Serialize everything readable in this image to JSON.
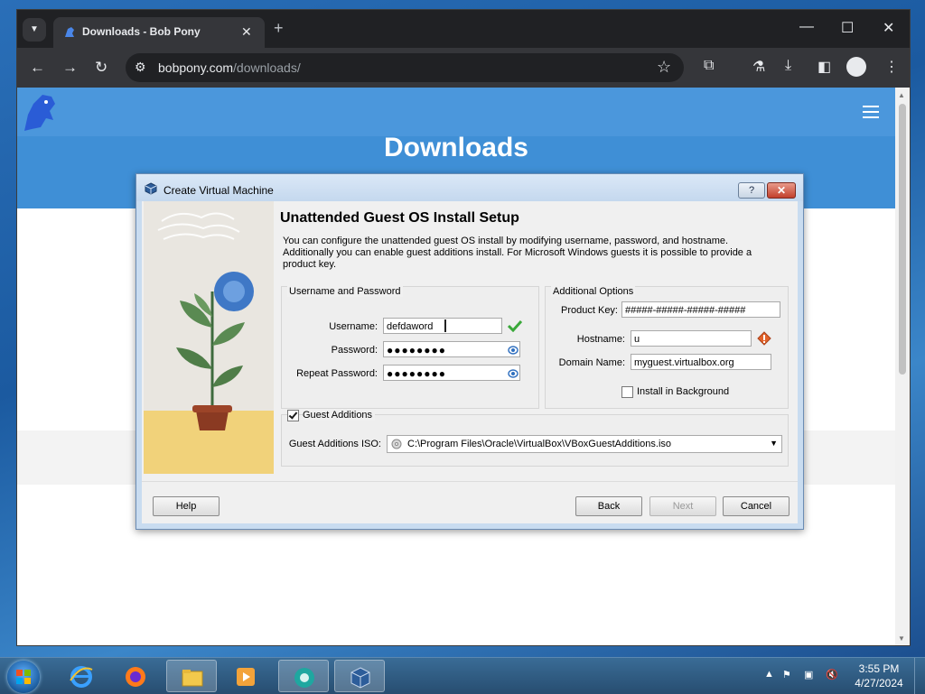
{
  "browser": {
    "tab_title": "Downloads - Bob Pony",
    "url_host": "bobpony.com",
    "url_path": "/downloads/",
    "new_tab": "+",
    "tab_close": "✕",
    "minimize": "—",
    "maximize": "☐",
    "close": "✕"
  },
  "page": {
    "title": "Downloads"
  },
  "dialog": {
    "window_title": "Create Virtual Machine",
    "help_title": "?",
    "close_title": "✕",
    "heading": "Unattended Guest OS Install Setup",
    "description": "You can configure the unattended guest OS install by modifying username, password, and hostname. Additionally you can enable guest additions install. For Microsoft Windows guests it is possible to provide a product key.",
    "user_group": {
      "title": "Username and Password",
      "username_label": "Username:",
      "username_value": "defdaword",
      "password_label": "Password:",
      "password_value": "●●●●●●●●",
      "repeat_label": "Repeat Password:",
      "repeat_value": "●●●●●●●●"
    },
    "options_group": {
      "title": "Additional Options",
      "product_key_label": "Product Key:",
      "product_key_value": "#####-#####-#####-#####",
      "hostname_label": "Hostname:",
      "hostname_value": "u",
      "domain_label": "Domain Name:",
      "domain_value": "myguest.virtualbox.org",
      "install_bg_label": "Install in Background",
      "install_bg_checked": false
    },
    "guest_additions": {
      "label": "Guest Additions",
      "checked": true,
      "iso_label": "Guest Additions ISO:",
      "iso_value": "C:\\Program Files\\Oracle\\VirtualBox\\VBoxGuestAdditions.iso"
    },
    "buttons": {
      "help": "Help",
      "back": "Back",
      "next": "Next",
      "cancel": "Cancel"
    }
  },
  "taskbar": {
    "time": "3:55 PM",
    "date": "4/27/2024"
  },
  "colors": {
    "hero_blue": "#3f8fd6",
    "browser_dark": "#202124",
    "dialog_frame": "#c9dcf0",
    "ok_green": "#3aa83a",
    "warn_orange": "#e2622a"
  }
}
